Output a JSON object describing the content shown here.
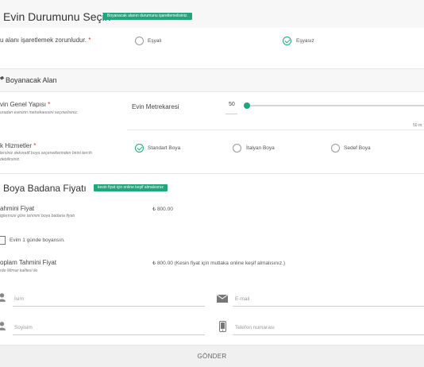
{
  "section1": {
    "title": "Evin Durumunu Seçin",
    "badge": "Boyanacak alanın durumunu işaretlemelisiniz.",
    "required_text": "u alanı işaretlemek zorunludur.",
    "asterisk": "*",
    "options": [
      "Eşyalı",
      "Eşyasız"
    ],
    "selected_option": "Eşyasız"
  },
  "section2": {
    "title": "Boyanacak Alan",
    "general": {
      "label": "vin Genel Yapısı",
      "asterisk": "*",
      "hint": "uradan evinizin metrekaresini seçmelisiniz."
    },
    "area": {
      "label": "Evin Metrekaresi",
      "value": "50",
      "slider_end_label": "50 m",
      "slider_level_percent": 0
    },
    "services": {
      "label": "k Hizmetler",
      "asterisk": "*",
      "hint_line1": "lersiniz dekoratif boya seçeneklerinden birini tercih",
      "hint_line2": "debilirsiniz.",
      "options": [
        "Standart Boya",
        "İtalyan Boya",
        "Sedef Boya"
      ],
      "selected_option": "Standart Boya"
    }
  },
  "section3": {
    "title": "Boya Badana Fiyatı",
    "badge": "kesin fiyat için online keşif almalısınız",
    "estimate": {
      "label": "ahmini Fiyat",
      "hint": "iglerinize göre tahmini boya badana fiyatı",
      "value": "₺ 800.00"
    },
    "one_day_checkbox": {
      "label": "Evim 1 günde boyansın.",
      "checked": false
    },
    "total": {
      "label": "oplam Tahmini Fiyat",
      "hint": "rde Mimar kalitesi ile",
      "value": "₺ 800.00 (Kesin fiyat için mutlaka online keşif almalısınız.)"
    }
  },
  "form": {
    "name_placeholder": "İsim",
    "email_placeholder": "E-mail",
    "surname_placeholder": "Soyisim",
    "phone_placeholder": "Telefon numarası",
    "submit_label": "GÖNDER"
  },
  "colors": {
    "accent": "#1fa67a",
    "section_bg": "#f7f7f7"
  },
  "icons": [
    "paint-bucket-icon",
    "user-icon",
    "envelope-icon",
    "phone-icon"
  ]
}
